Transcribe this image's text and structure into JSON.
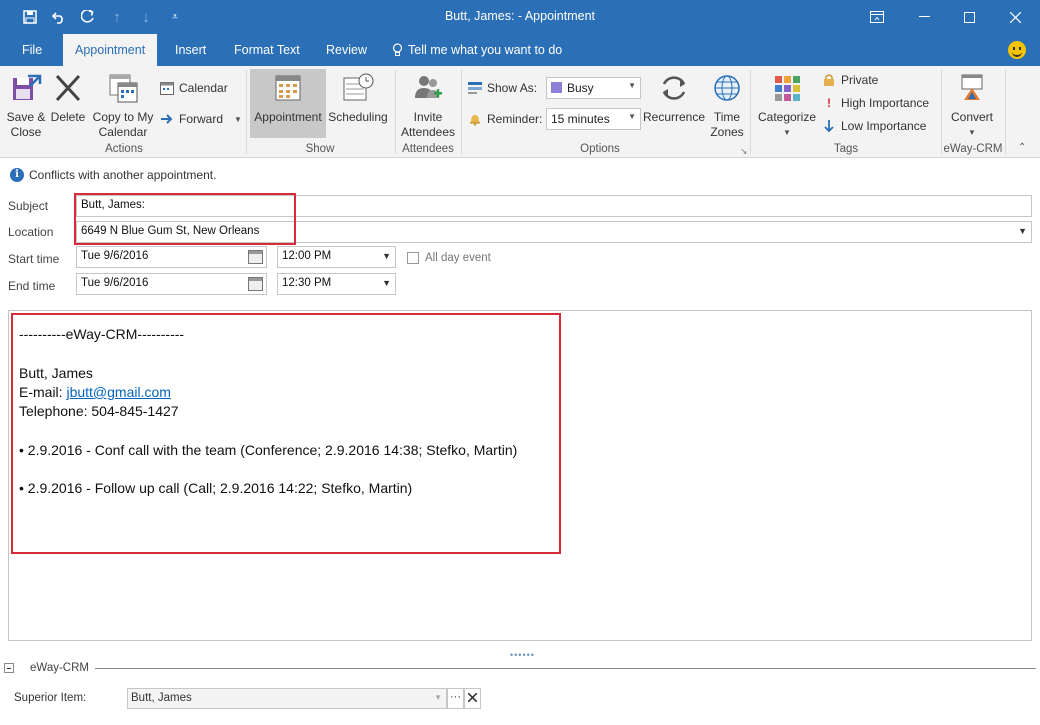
{
  "window": {
    "title": "Butt, James:  -  Appointment"
  },
  "tabs": [
    "File",
    "Appointment",
    "Insert",
    "Format Text",
    "Review"
  ],
  "tell_me": "Tell me what you want to do",
  "ribbon": {
    "actions": {
      "save_close_l1": "Save &",
      "save_close_l2": "Close",
      "delete": "Delete",
      "copy_l1": "Copy to My",
      "copy_l2": "Calendar",
      "calendar": "Calendar",
      "forward": "Forward",
      "group": "Actions"
    },
    "show": {
      "appointment": "Appointment",
      "scheduling": "Scheduling",
      "group": "Show"
    },
    "attendees": {
      "invite_l1": "Invite",
      "invite_l2": "Attendees",
      "group": "Attendees"
    },
    "options": {
      "show_as_label": "Show As:",
      "show_as_value": "Busy",
      "reminder_label": "Reminder:",
      "reminder_value": "15 minutes",
      "recurrence": "Recurrence",
      "time_l1": "Time",
      "time_l2": "Zones",
      "group": "Options"
    },
    "tags": {
      "categorize": "Categorize",
      "private": "Private",
      "high": "High Importance",
      "low": "Low Importance",
      "group": "Tags"
    },
    "eway": {
      "convert": "Convert",
      "group": "eWay-CRM"
    }
  },
  "form": {
    "info": "Conflicts with another appointment.",
    "subject_label": "Subject",
    "subject_value": "Butt, James:",
    "location_label": "Location",
    "location_value": "6649 N Blue Gum St, New Orleans",
    "start_label": "Start time",
    "start_date": "Tue 9/6/2016",
    "start_time": "12:00 PM",
    "all_day": "All day event",
    "end_label": "End time",
    "end_date": "Tue 9/6/2016",
    "end_time": "12:30 PM"
  },
  "body": {
    "header": "----------eWay-CRM----------",
    "name": "Butt, James",
    "email_label": "E-mail: ",
    "email": "jbutt@gmail.com",
    "phone": "Telephone: 504-845-1427",
    "item1": "• 2.9.2016 - Conf call with the team (Conference; 2.9.2016 14:38; Stefko, Martin)",
    "item2": "• 2.9.2016 - Follow up call (Call; 2.9.2016 14:22; Stefko, Martin)"
  },
  "eway_panel": {
    "title": "eWay-CRM",
    "superior_label": "Superior Item:",
    "superior_value": "Butt, James"
  },
  "colors": {
    "titlebar": "#2b6fb6",
    "highlight_box": "#d62b3a",
    "busy": "#8f7fd8",
    "link": "#0563c1"
  }
}
